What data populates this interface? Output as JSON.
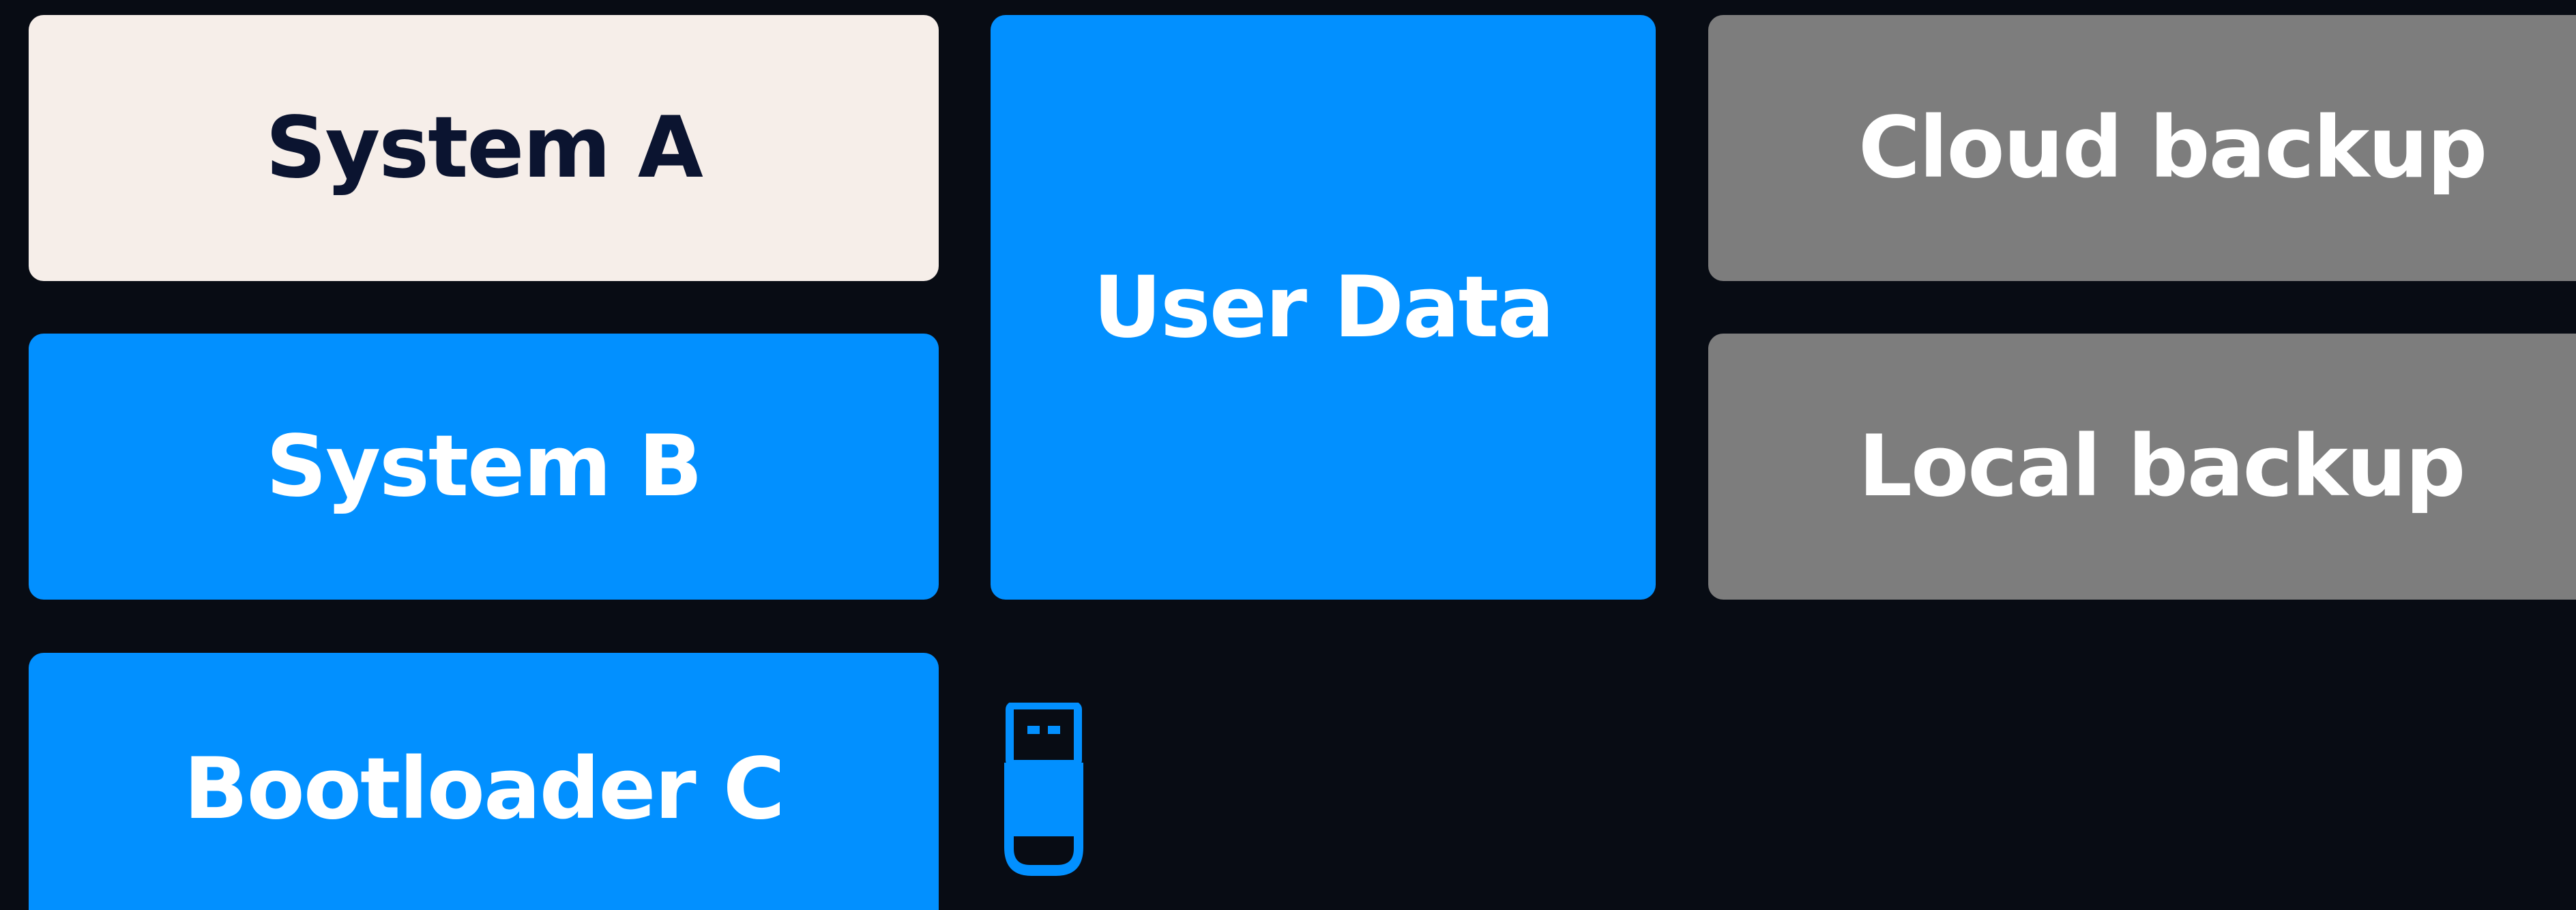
{
  "tiles": {
    "system_a": "System A",
    "system_b": "System B",
    "bootloader_c": "Bootloader C",
    "user_data": "User Data",
    "cloud_backup": "Cloud backup",
    "local_backup": "Local backup"
  },
  "icons": {
    "usb": "usb-drive-icon"
  },
  "colors": {
    "background": "#080c14",
    "active_blue": "#0290ff",
    "selected_light": "#f6eee9",
    "inactive_gray": "#7d7d7d",
    "dark_text": "#0b1430"
  }
}
